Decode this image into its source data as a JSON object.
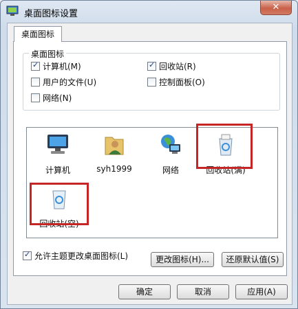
{
  "window": {
    "title": "桌面图标设置",
    "close_symbol": "✕"
  },
  "tabs": [
    {
      "label": "桌面图标",
      "selected": true
    }
  ],
  "group": {
    "title": "桌面图标",
    "checkboxes": [
      {
        "label": "计算机(M)",
        "checked": true
      },
      {
        "label": "回收站(R)",
        "checked": true
      },
      {
        "label": "用户的文件(U)",
        "checked": false
      },
      {
        "label": "控制面板(O)",
        "checked": false
      },
      {
        "label": "网络(N)",
        "checked": false
      }
    ]
  },
  "icons": [
    {
      "label": "计算机",
      "icon": "computer-icon"
    },
    {
      "label": "syh1999",
      "icon": "user-folder-icon"
    },
    {
      "label": "网络",
      "icon": "network-icon"
    },
    {
      "label": "回收站(满)",
      "icon": "recycle-bin-full-icon"
    },
    {
      "label": "回收站(空)",
      "icon": "recycle-bin-empty-icon"
    }
  ],
  "buttons": {
    "change_icon": "更改图标(H)...",
    "restore_default": "还原默认值(S)",
    "ok": "确定",
    "cancel": "取消",
    "apply": "应用(A)"
  },
  "allow_theme": {
    "label": "允许主题更改桌面图标(L)",
    "checked": true
  },
  "colors": {
    "highlight": "#c52525",
    "titlebar": "#cfdceb",
    "close_button": "#c9614a"
  }
}
